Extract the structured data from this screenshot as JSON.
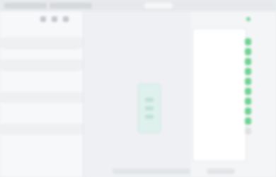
{
  "sidebar": {
    "rows": [
      {
        "label": "",
        "value": ""
      },
      {
        "label": "",
        "value": ""
      },
      {
        "label": "",
        "value": ""
      },
      {
        "label": "",
        "value": ""
      },
      {
        "label": "",
        "value": ""
      },
      {
        "label": "",
        "value": ""
      },
      {
        "label": "",
        "value": ""
      },
      {
        "label": "",
        "value": ""
      },
      {
        "label": "",
        "value": ""
      },
      {
        "label": "",
        "value": ""
      },
      {
        "label": "",
        "value": ""
      },
      {
        "label": "",
        "value": ""
      }
    ]
  },
  "main": {
    "caption": ""
  },
  "panel": {
    "header": "",
    "items": [
      "",
      "",
      "",
      "",
      "",
      "",
      "",
      "",
      "",
      "",
      ""
    ],
    "toggles": [
      true,
      true,
      true,
      true,
      true,
      true,
      true,
      true,
      true,
      false
    ]
  },
  "colors": {
    "accent_green": "#6fd392",
    "card_teal": "#dff1ec",
    "background": "#eceef1"
  },
  "icons": [
    "sidebar-tool-icon",
    "green-status-icon"
  ]
}
